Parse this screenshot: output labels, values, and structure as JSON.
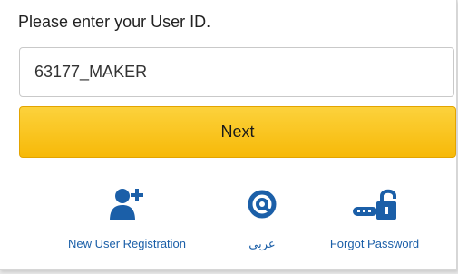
{
  "login": {
    "prompt": "Please enter your User ID.",
    "user_id_value": "63177_MAKER",
    "next_label": "Next"
  },
  "links": [
    {
      "label": "New User Registration",
      "icon": "add-user-icon"
    },
    {
      "label": "عربي",
      "icon": "at-sign-icon"
    },
    {
      "label": "Forgot Password",
      "icon": "unlock-key-icon"
    }
  ],
  "colors": {
    "accent": "#f7b908",
    "link": "#1b5fa8",
    "icon": "#1b5fa8"
  }
}
